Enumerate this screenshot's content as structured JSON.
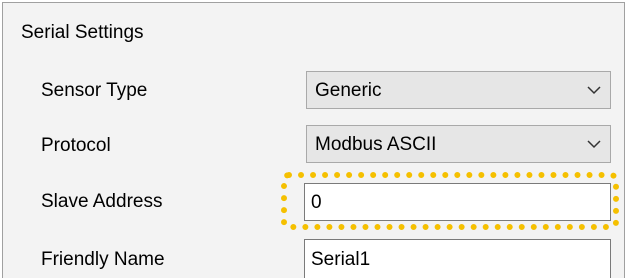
{
  "group": {
    "title": "Serial Settings"
  },
  "fields": {
    "sensor_type": {
      "label": "Sensor Type",
      "value": "Generic"
    },
    "protocol": {
      "label": "Protocol",
      "value": "Modbus ASCII"
    },
    "slave_address": {
      "label": "Slave Address",
      "value": "0"
    },
    "friendly_name": {
      "label": "Friendly Name",
      "value": "Serial1"
    }
  },
  "icons": {
    "dropdown": "chevron-down-icon"
  },
  "colors": {
    "highlight": "#f5c000",
    "panel_background": "#f3f3f3"
  }
}
